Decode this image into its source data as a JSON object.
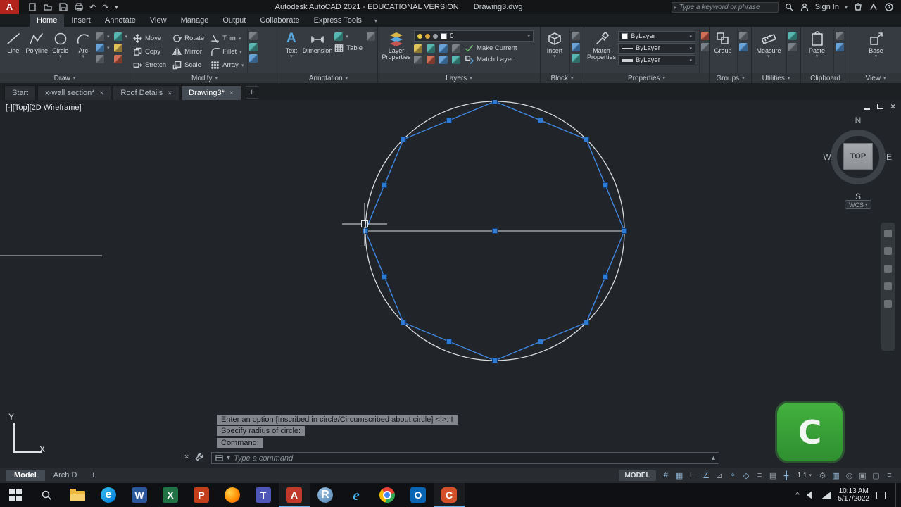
{
  "titlebar": {
    "title": "Autodesk AutoCAD 2021 - EDUCATIONAL VERSION",
    "doc": "Drawing3.dwg",
    "search_placeholder": "Type a keyword or phrase",
    "sign_in": "Sign In"
  },
  "ribbon_tabs": [
    "Home",
    "Insert",
    "Annotate",
    "View",
    "Manage",
    "Output",
    "Collaborate",
    "Express Tools"
  ],
  "ribbon": {
    "draw": {
      "label": "Draw",
      "line": "Line",
      "polyline": "Polyline",
      "circle": "Circle",
      "arc": "Arc"
    },
    "modify": {
      "label": "Modify",
      "move": "Move",
      "rotate": "Rotate",
      "trim": "Trim",
      "copy": "Copy",
      "mirror": "Mirror",
      "fillet": "Fillet",
      "stretch": "Stretch",
      "scale": "Scale",
      "array": "Array"
    },
    "annotation": {
      "label": "Annotation",
      "text": "Text",
      "dimension": "Dimension",
      "table": "Table"
    },
    "layers": {
      "label": "Layers",
      "big": "Layer Properties",
      "current": "0",
      "make_current": "Make Current",
      "match_layer": "Match Layer"
    },
    "block": {
      "label": "Block",
      "big": "Insert"
    },
    "properties": {
      "label": "Properties",
      "big": "Match Properties",
      "color": "ByLayer",
      "linetype": "ByLayer",
      "lineweight": "ByLayer"
    },
    "groups": {
      "label": "Groups",
      "big": "Group"
    },
    "utilities": {
      "label": "Utilities",
      "big": "Measure"
    },
    "clipboard": {
      "label": "Clipboard",
      "big": "Paste"
    },
    "view": {
      "label": "View",
      "big": "Base"
    }
  },
  "file_tabs": [
    "Start",
    "x-wall section*",
    "Roof Details",
    "Drawing3*"
  ],
  "canvas": {
    "viewport_label": "[-][Top][2D Wireframe]",
    "ucs_x": "X",
    "ucs_y": "Y"
  },
  "viewcube": {
    "n": "N",
    "e": "E",
    "s": "S",
    "w": "W",
    "face": "TOP",
    "wcs": "WCS"
  },
  "command": {
    "h0": "Enter an option [Inscribed in circle/Circumscribed about circle] <I>: I",
    "h1": "Specify radius of circle:",
    "h2": "Command:",
    "placeholder": "Type a command"
  },
  "model_tabs": {
    "model": "Model",
    "layout": "Arch D",
    "add": "+"
  },
  "statusbar": {
    "model": "MODEL",
    "scale": "1:1"
  },
  "taskbar": {
    "time": "10:13 AM",
    "date": "5/17/2022",
    "apps": {
      "word": "W",
      "excel": "X",
      "powerpoint": "P",
      "teams": "T",
      "autocad": "A",
      "rstudio": "R",
      "ie": "e",
      "outlook": "O",
      "camtasia": "C"
    }
  },
  "watermark": {
    "letter": "C"
  },
  "icons": {
    "caret": "▾",
    "caret_up": "▴",
    "close": "×",
    "plus": "+",
    "undo": "↶",
    "redo": "↷",
    "search_arrow": "▸",
    "grid": "#",
    "snap": "▦",
    "ortho": "∟",
    "polar": "∠",
    "iso": "⊿",
    "otrack": "⌖",
    "osnap": "◇",
    "lineweight": "≡",
    "transparency": "▤",
    "dyninput": "╋",
    "gear": "⚙",
    "annovis": "▥",
    "monitor": "◎",
    "lockui": "▣",
    "clean": "▢",
    "chevron_up": "^",
    "hamburger": "≡"
  }
}
